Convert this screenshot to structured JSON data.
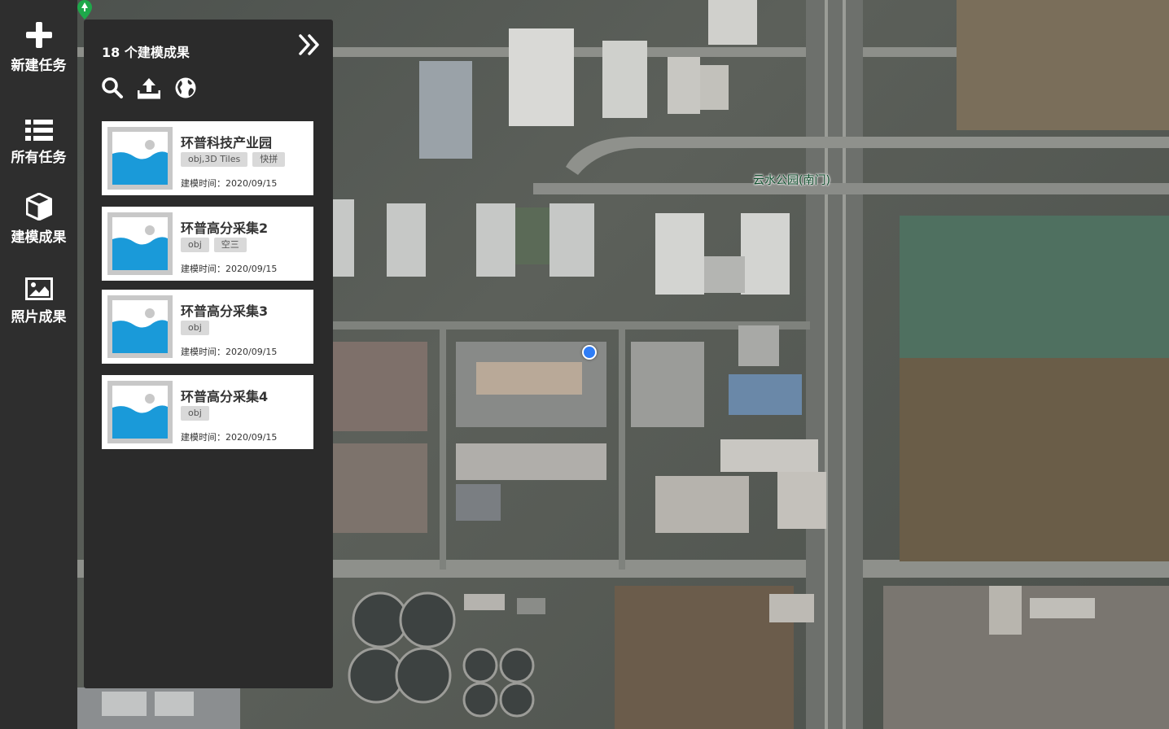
{
  "nav": {
    "items": [
      {
        "label": "新建任务",
        "icon": "plus-icon"
      },
      {
        "label": "所有任务",
        "icon": "list-icon"
      },
      {
        "label": "建模成果",
        "icon": "cube-icon"
      },
      {
        "label": "照片成果",
        "icon": "image-icon"
      }
    ]
  },
  "panel": {
    "title": "18 个建模成果",
    "tools": [
      "search-icon",
      "upload-icon",
      "globe-icon"
    ],
    "cards": [
      {
        "title": "环普科技产业园",
        "tags": [
          "obj,3D Tiles",
          "快拼"
        ],
        "time": "建模时间：2020/09/15"
      },
      {
        "title": "环普高分采集2",
        "tags": [
          "obj",
          "空三"
        ],
        "time": "建模时间：2020/09/15"
      },
      {
        "title": "环普高分采集3",
        "tags": [
          "obj"
        ],
        "time": "建模时间：2020/09/15"
      },
      {
        "title": "环普高分采集4",
        "tags": [
          "obj"
        ],
        "time": "建模时间：2020/09/15"
      }
    ]
  },
  "map": {
    "poi_label": "云水公园(南门)"
  },
  "colors": {
    "nav_bg": "#2e2e2e",
    "panel_bg": "#2b2b2b",
    "thumb_blue": "#1a9ad9",
    "location_dot": "#2f7df6"
  }
}
